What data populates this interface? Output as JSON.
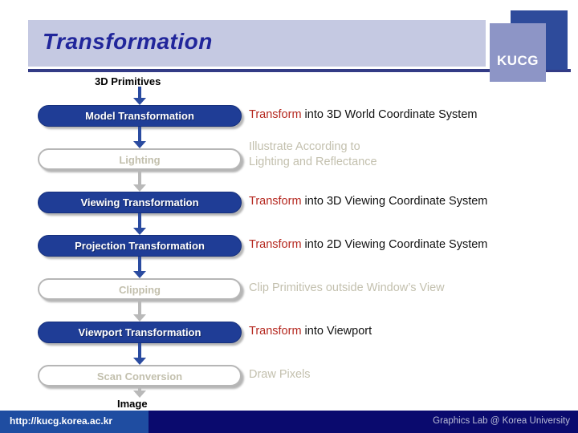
{
  "header": {
    "title": "Transformation",
    "logo_text": "KUCG"
  },
  "diagram": {
    "input_label": "3D Primitives",
    "output_label": "Image",
    "stages": [
      {
        "name": "Model Transformation",
        "state": "active",
        "desc_keyword": "Transform",
        "desc_rest": " into 3D World Coordinate System",
        "desc_line2": ""
      },
      {
        "name": "Lighting",
        "state": "disabled",
        "desc_keyword": "",
        "desc_rest": "Illustrate According to",
        "desc_line2": "Lighting and Reflectance"
      },
      {
        "name": "Viewing Transformation",
        "state": "active",
        "desc_keyword": "Transform",
        "desc_rest": " into 3D Viewing Coordinate System",
        "desc_line2": ""
      },
      {
        "name": "Projection Transformation",
        "state": "active",
        "desc_keyword": "Transform",
        "desc_rest": " into 2D Viewing Coordinate System",
        "desc_line2": ""
      },
      {
        "name": "Clipping",
        "state": "disabled",
        "desc_keyword": "",
        "desc_rest": "Clip Primitives outside Window’s View",
        "desc_line2": ""
      },
      {
        "name": "Viewport Transformation",
        "state": "active",
        "desc_keyword": "Transform",
        "desc_rest": " into Viewport",
        "desc_line2": ""
      },
      {
        "name": "Scan Conversion",
        "state": "disabled",
        "desc_keyword": "",
        "desc_rest": "Draw Pixels",
        "desc_line2": ""
      }
    ]
  },
  "footer": {
    "url": "http://kucg.korea.ac.kr",
    "credit": "Graphics Lab @ Korea University"
  },
  "colors": {
    "accent_blue": "#1f3d96",
    "keyword_red": "#b5281f",
    "disabled_gray": "#c3c0ae",
    "header_band": "#c5c9e2",
    "title_blue": "#21269b",
    "footer_navy": "#0a0a6e",
    "footer_blue": "#1f4da1"
  }
}
